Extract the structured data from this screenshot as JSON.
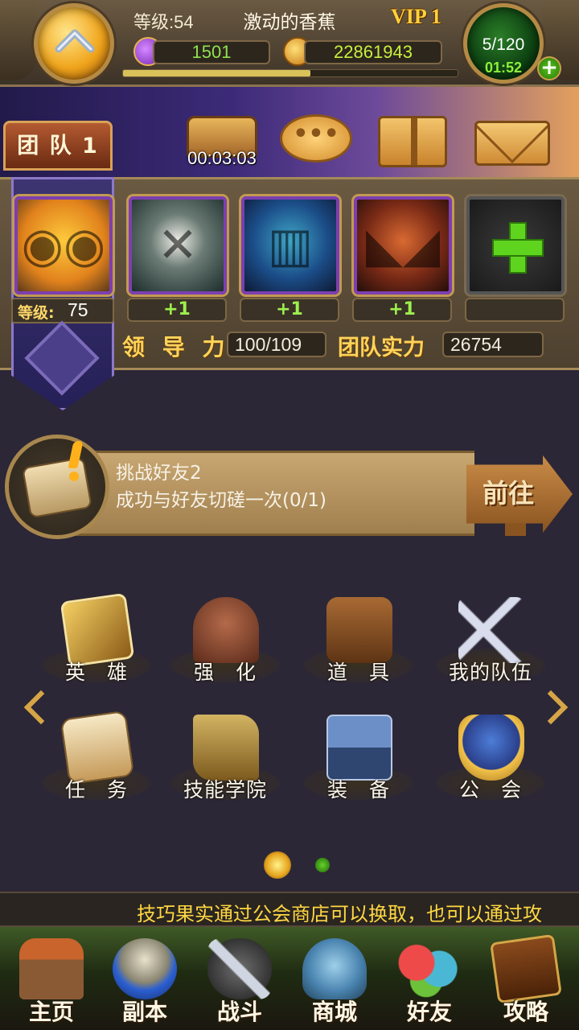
{
  "header": {
    "level_label": "等级:54",
    "player_name": "激动的香蕉",
    "vip_label": "VIP 1",
    "gems": "1501",
    "gold": "22861943",
    "exp_progress": 0.56,
    "energy": "5/120",
    "energy_timer": "01:52",
    "energy_add_label": "+"
  },
  "toolbar": {
    "team_tab_label": "团 队 1",
    "chest_timer": "00:03:03",
    "chat_glyph": "•••"
  },
  "team": {
    "leader_level_label": "等级:",
    "leader_level_value": "75",
    "slots": [
      {
        "bonus": "+1"
      },
      {
        "bonus": "+1"
      },
      {
        "bonus": "+1"
      },
      {
        "bonus": ""
      }
    ],
    "leadership_label": "领 导 力",
    "leadership_value": "100/109",
    "power_label": "团队实力",
    "power_value": "26754"
  },
  "quest": {
    "title": "挑战好友2",
    "description": "成功与好友切磋一次(0/1)",
    "goto_label": "前往"
  },
  "menu": {
    "items": [
      {
        "label": "英　雄",
        "icon": "hero-book-icon"
      },
      {
        "label": "强　化",
        "icon": "forge-helmet-icon"
      },
      {
        "label": "道　具",
        "icon": "bag-icon"
      },
      {
        "label": "我的队伍",
        "icon": "crossed-swords-icon"
      },
      {
        "label": "任　务",
        "icon": "scroll-icon"
      },
      {
        "label": "技能学院",
        "icon": "spellbook-icon"
      },
      {
        "label": "装　备",
        "icon": "anvil-icon"
      },
      {
        "label": "公　会",
        "icon": "guild-shield-icon"
      }
    ],
    "page_count": 2,
    "current_page": 1
  },
  "ticker": {
    "text": "技巧果实通过公会商店可以换取，也可以通过攻"
  },
  "bottom_nav": {
    "tabs": [
      {
        "label": "主页",
        "icon": "house-icon"
      },
      {
        "label": "副本",
        "icon": "skull-orb-icon"
      },
      {
        "label": "战斗",
        "icon": "sword-axe-icon"
      },
      {
        "label": "商城",
        "icon": "shop-monster-icon"
      },
      {
        "label": "好友",
        "icon": "friends-icon"
      },
      {
        "label": "攻略",
        "icon": "guide-book-icon"
      }
    ]
  },
  "colors": {
    "accent_gold": "#ffd35a",
    "value_green": "#8ee24f",
    "panel_brown": "#6b5a42",
    "ticker_yellow": "#ffd742"
  }
}
